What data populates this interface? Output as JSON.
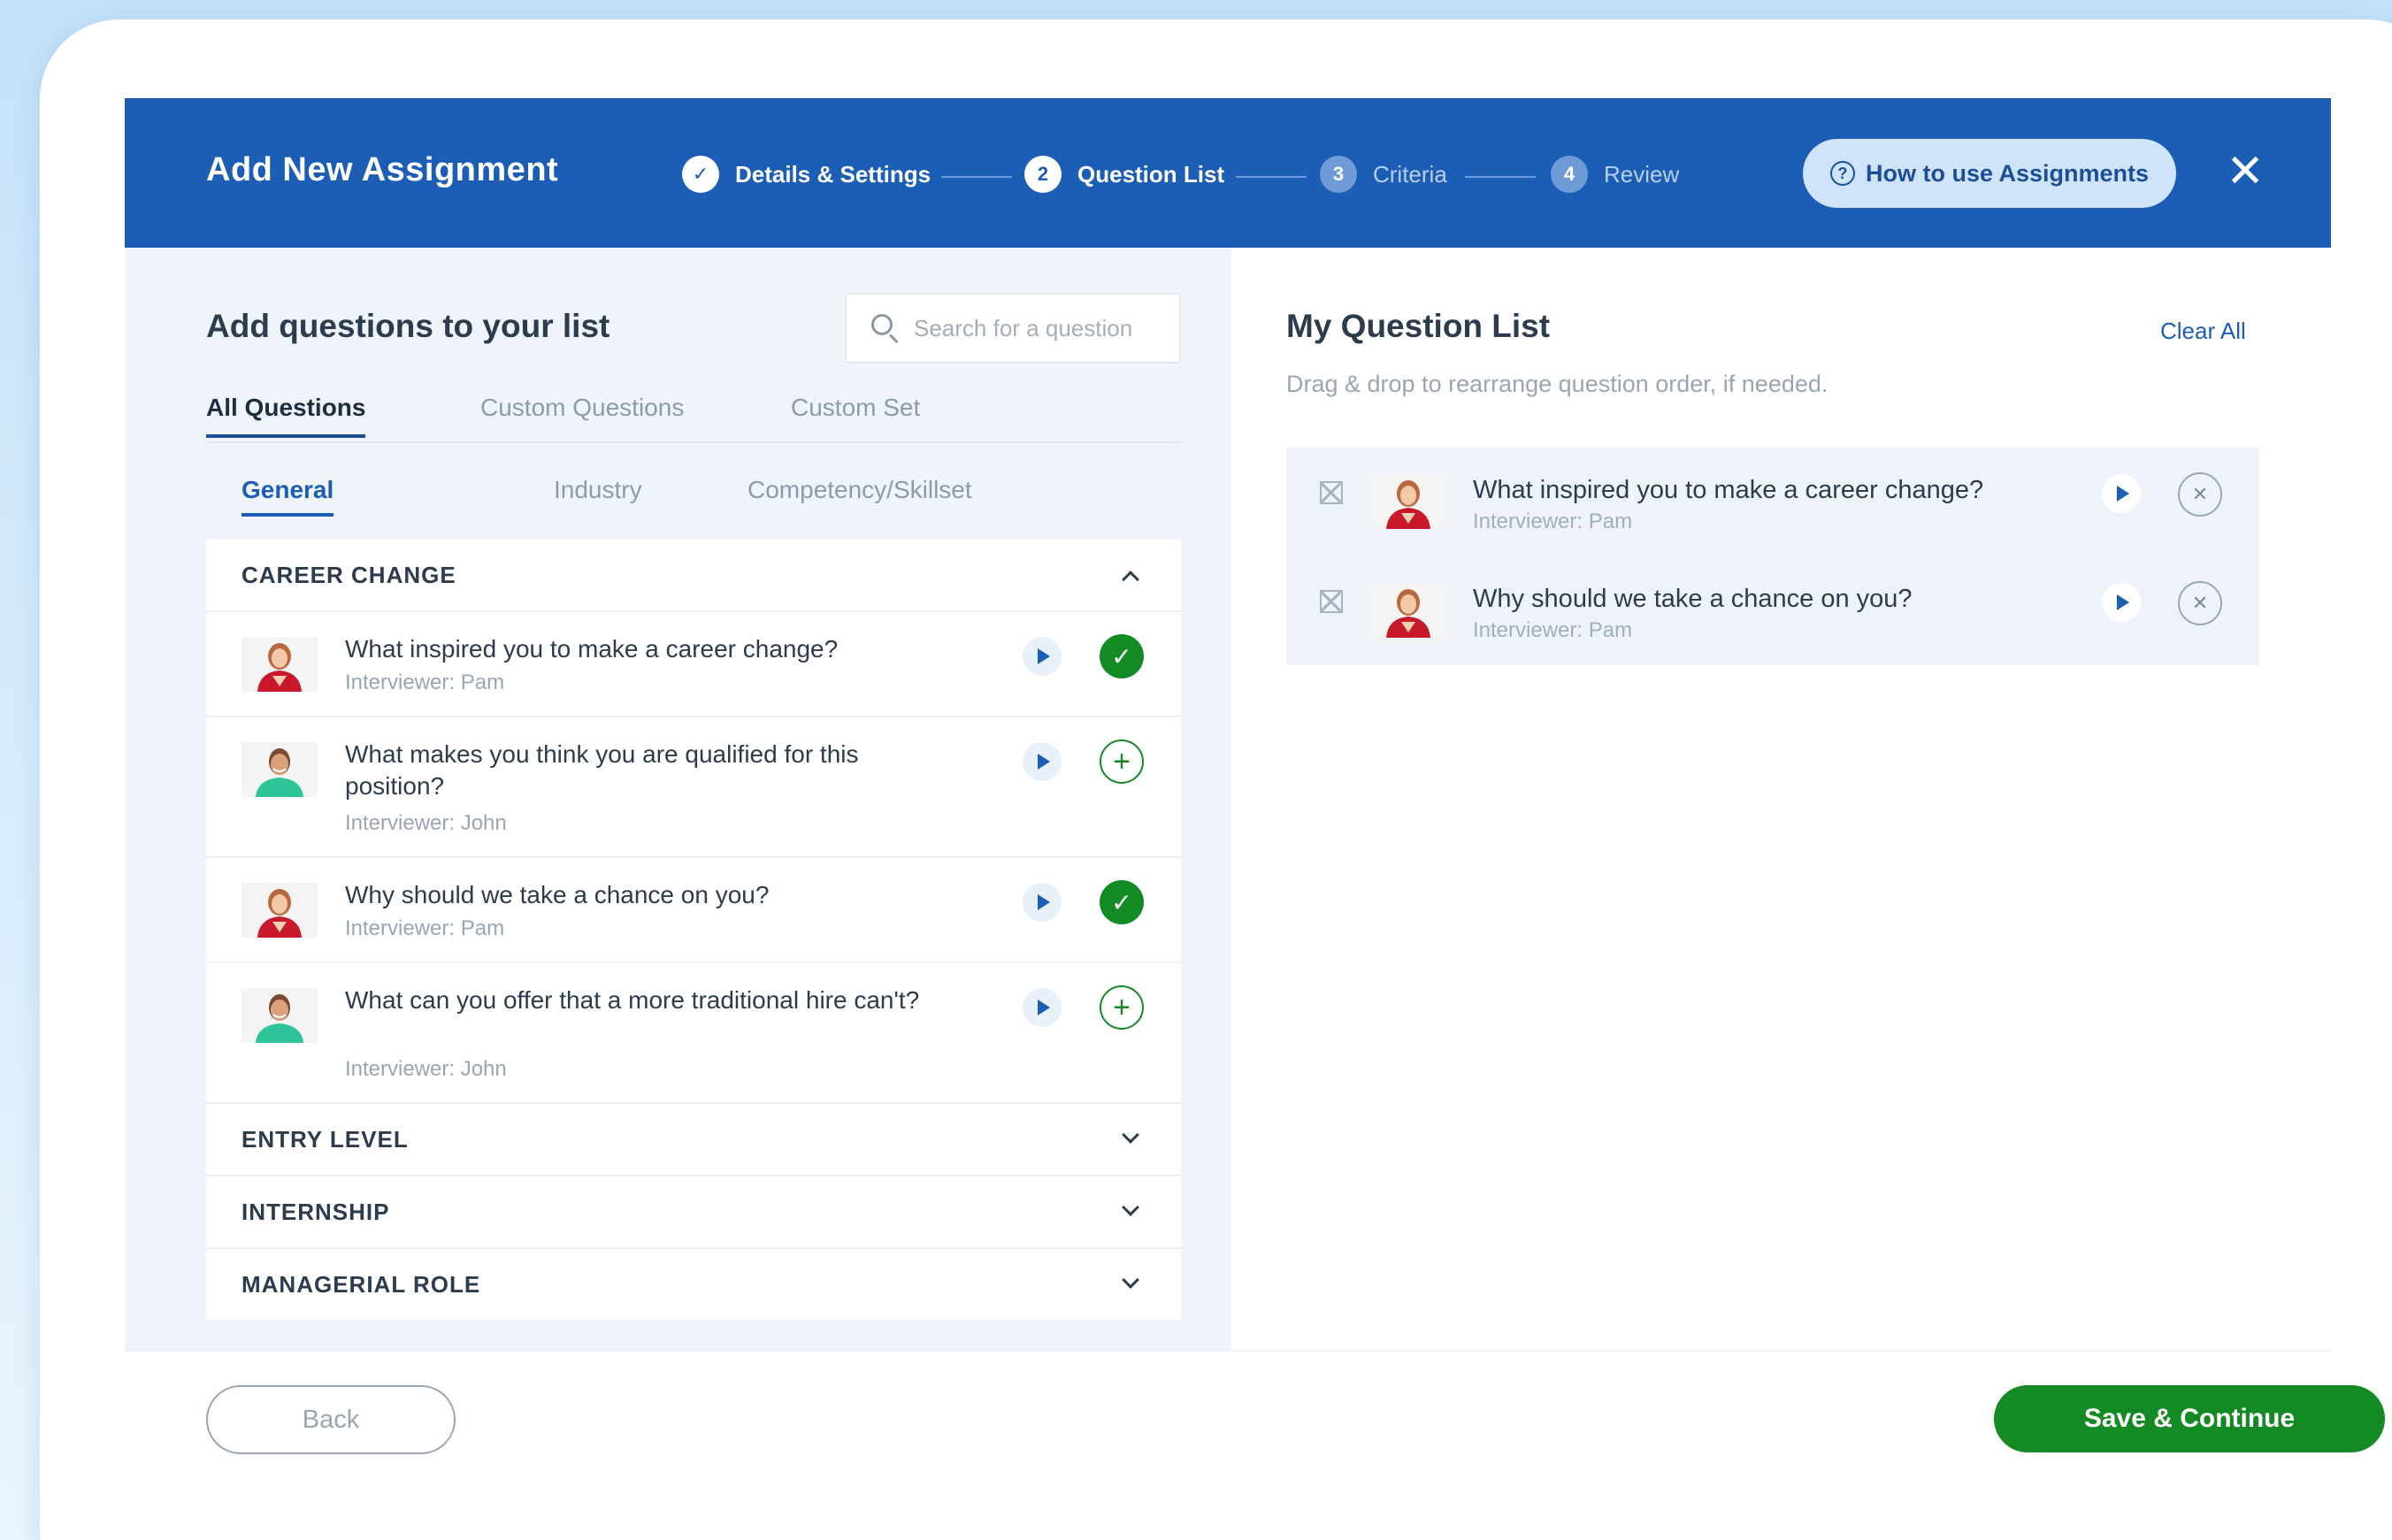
{
  "header": {
    "title": "Add New Assignment",
    "steps": [
      {
        "number": "✓",
        "label": "Details & Settings",
        "state": "done"
      },
      {
        "number": "2",
        "label": "Question List",
        "state": "active"
      },
      {
        "number": "3",
        "label": "Criteria",
        "state": "pending"
      },
      {
        "number": "4",
        "label": "Review",
        "state": "pending"
      }
    ],
    "help_label": "How to use Assignments",
    "help_icon": "question-circle-icon",
    "close_icon": "close-icon"
  },
  "left": {
    "title": "Add questions to your list",
    "search_placeholder": "Search for a question",
    "tabs": [
      "All Questions",
      "Custom Questions",
      "Custom Set"
    ],
    "subtabs": [
      "General",
      "Industry",
      "Competency/Skillset"
    ],
    "categories": [
      {
        "name": "CAREER CHANGE",
        "expanded": true,
        "questions": [
          {
            "text": "What inspired you to make a career change?",
            "interviewer": "Interviewer: Pam",
            "added": true
          },
          {
            "text": "What makes you think you are qualified for this position?",
            "interviewer": "Interviewer: John",
            "added": false
          },
          {
            "text": "Why should we take a chance on you?",
            "interviewer": "Interviewer: Pam",
            "added": true
          },
          {
            "text": "What can you offer that a more traditional hire can't?",
            "interviewer": "Interviewer: John",
            "added": false
          }
        ]
      },
      {
        "name": "ENTRY LEVEL",
        "expanded": false
      },
      {
        "name": "INTERNSHIP",
        "expanded": false
      },
      {
        "name": "MANAGERIAL ROLE",
        "expanded": false
      }
    ]
  },
  "right": {
    "title": "My Question List",
    "clear_label": "Clear All",
    "subtitle": "Drag & drop to rearrange question order, if needed.",
    "items": [
      {
        "text": "What inspired you to make a career change?",
        "interviewer": "Interviewer: Pam"
      },
      {
        "text": "Why should we take a chance on you?",
        "interviewer": "Interviewer: Pam"
      }
    ]
  },
  "footer": {
    "back_label": "Back",
    "save_label": "Save & Continue"
  },
  "colors": {
    "header_blue": "#1c5db5",
    "success_green": "#148a24",
    "panel_bg": "#eff4fb"
  }
}
